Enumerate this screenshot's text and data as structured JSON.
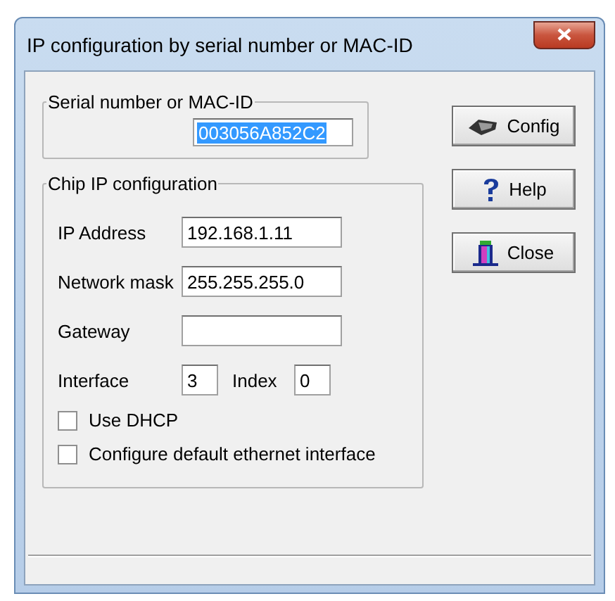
{
  "window": {
    "title": "IP configuration by serial number or MAC-ID"
  },
  "serial_group": {
    "title": "Serial number or MAC-ID",
    "value": "003056A852C2",
    "selected": true
  },
  "chip_group": {
    "title": "Chip IP configuration",
    "fields": [
      {
        "label": "IP Address",
        "value": "192.168.1.11"
      },
      {
        "label": "Network mask",
        "value": "255.255.255.0"
      },
      {
        "label": "Gateway"
      }
    ],
    "interface": {
      "label": "Interface",
      "value": "3"
    },
    "index": {
      "label": "Index",
      "value": "0"
    },
    "checkboxes": [
      {
        "label": "Use DHCP",
        "checked": false
      },
      {
        "label": "Configure default ethernet interface",
        "checked": false
      }
    ]
  },
  "buttons": [
    {
      "kind": "config",
      "label": "Config"
    },
    {
      "kind": "help",
      "label": "Help"
    },
    {
      "kind": "close",
      "label": "Close"
    }
  ]
}
